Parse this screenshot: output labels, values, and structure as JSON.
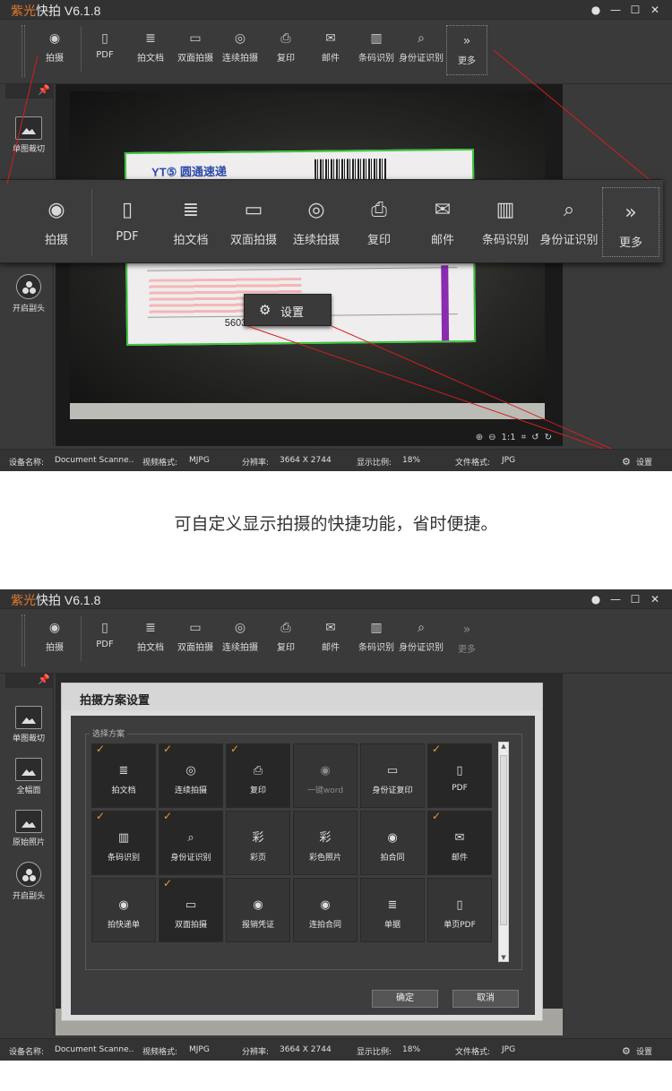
{
  "app": {
    "title_brand": "紫光",
    "title_rest": "快拍 V6.1.8",
    "window_controls": [
      "●",
      "—",
      "☐",
      "✕"
    ]
  },
  "toolbar": {
    "items": [
      {
        "label": "拍摄",
        "icon": "camera-icon"
      },
      {
        "label": "PDF",
        "icon": "pdf-icon"
      },
      {
        "label": "拍文档",
        "icon": "document-icon"
      },
      {
        "label": "双面拍摄",
        "icon": "id-card-icon"
      },
      {
        "label": "连续拍摄",
        "icon": "continuous-camera-icon"
      },
      {
        "label": "复印",
        "icon": "printer-icon"
      },
      {
        "label": "邮件",
        "icon": "mail-icon"
      },
      {
        "label": "条码识别",
        "icon": "barcode-icon"
      },
      {
        "label": "身份证识别",
        "icon": "id-scan-icon"
      },
      {
        "label": "更多",
        "icon": "double-chevron-icon"
      }
    ]
  },
  "left_panel": {
    "items": [
      "单图裁切",
      "全幅面",
      "原始照片",
      "开启副头"
    ]
  },
  "status": {
    "device_label": "设备名称:",
    "device_value": "Document Scanne..",
    "video_label": "视频格式:",
    "video_value": "MJPG",
    "res_label": "分辨率:",
    "res_value": "3664 X 2744",
    "ratio_label": "显示比例:",
    "ratio_value": "18%",
    "fmt_label": "文件格式:",
    "fmt_value": "JPG",
    "settings_label": "设置"
  },
  "preview": {
    "logo_text": "YT⑤ 圆通速递",
    "waybill_number": "5603",
    "zoom_tools": [
      "⊕",
      "⊖",
      "1:1",
      "⌗",
      "↺",
      "↻"
    ]
  },
  "popup": {
    "settings_label": "设置"
  },
  "caption": "可自定义显示拍摄的快捷功能，省时便捷。",
  "dialog": {
    "title": "拍摄方案设置",
    "group_label": "选择方案",
    "tiles": [
      {
        "label": "拍文档",
        "checked": true
      },
      {
        "label": "连续拍摄",
        "checked": true
      },
      {
        "label": "复印",
        "checked": true
      },
      {
        "label": "一键word",
        "checked": false
      },
      {
        "label": "身份证复印",
        "checked": false
      },
      {
        "label": "PDF",
        "checked": true
      },
      {
        "label": "条码识别",
        "checked": true
      },
      {
        "label": "身份证识别",
        "checked": true
      },
      {
        "label": "彩页",
        "checked": false
      },
      {
        "label": "彩色照片",
        "checked": false
      },
      {
        "label": "拍合同",
        "checked": false
      },
      {
        "label": "邮件",
        "checked": true
      },
      {
        "label": "拍快递单",
        "checked": false
      },
      {
        "label": "双面拍摄",
        "checked": true
      },
      {
        "label": "报销凭证",
        "checked": false
      },
      {
        "label": "连拍合同",
        "checked": false
      },
      {
        "label": "单据",
        "checked": false
      },
      {
        "label": "单页PDF",
        "checked": false
      }
    ],
    "tile_icons": [
      "doc-icon",
      "camera-seq-icon",
      "printer-icon",
      "camera-icon",
      "id-card-icon",
      "pdf-icon",
      "barcode-icon",
      "id-scan-icon",
      "color-page-icon",
      "color-photo-icon",
      "camera-icon",
      "mail-icon",
      "camera-icon",
      "id-card-icon",
      "camera-icon",
      "camera-icon",
      "doc-icon",
      "pdf-icon"
    ],
    "ok_label": "确定",
    "cancel_label": "取消"
  }
}
